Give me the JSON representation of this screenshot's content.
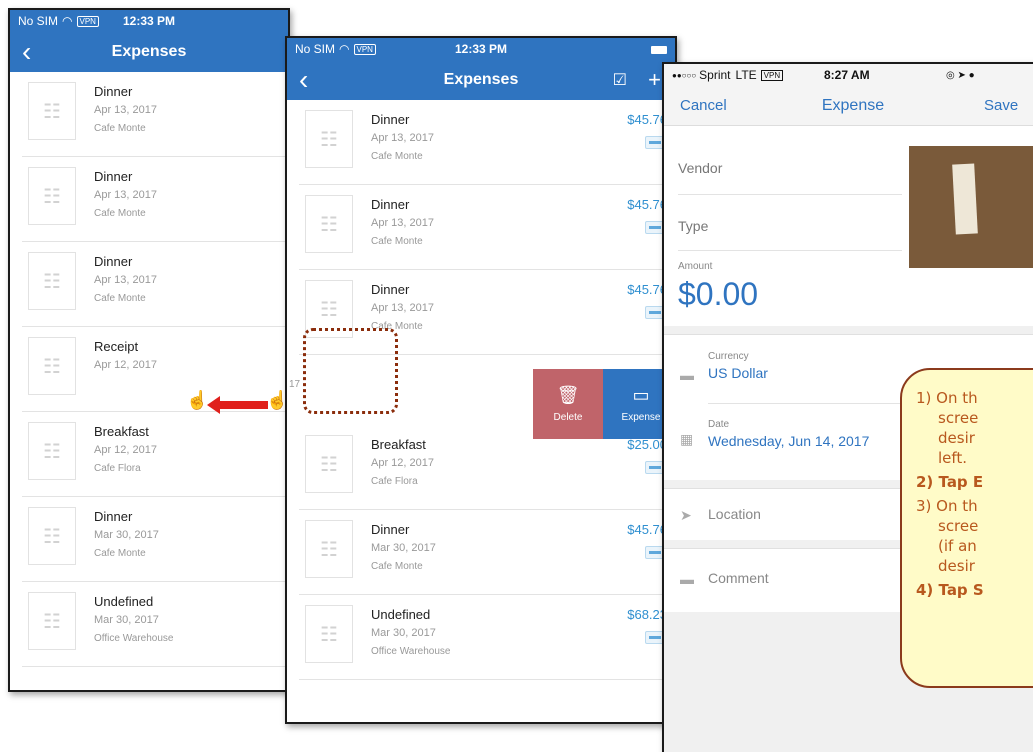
{
  "screen1": {
    "status": {
      "carrier": "No SIM",
      "vpn": "VPN",
      "time": "12:33 PM"
    },
    "nav": {
      "back_icon": "chevron-left-icon",
      "title": "Expenses"
    },
    "rows": [
      {
        "title": "Dinner",
        "date": "Apr 13, 2017",
        "vendor": "Cafe Monte"
      },
      {
        "title": "Dinner",
        "date": "Apr 13, 2017",
        "vendor": "Cafe Monte"
      },
      {
        "title": "Dinner",
        "date": "Apr 13, 2017",
        "vendor": "Cafe Monte"
      },
      {
        "title": "Receipt",
        "date": "Apr 12, 2017",
        "vendor": ""
      },
      {
        "title": "Breakfast",
        "date": "Apr 12, 2017",
        "vendor": "Cafe Flora"
      },
      {
        "title": "Dinner",
        "date": "Mar 30, 2017",
        "vendor": "Cafe Monte"
      },
      {
        "title": "Undefined",
        "date": "Mar 30, 2017",
        "vendor": "Office Warehouse"
      }
    ]
  },
  "screen2": {
    "status": {
      "carrier": "No SIM",
      "vpn": "VPN",
      "time": "12:33 PM"
    },
    "nav": {
      "title": "Expenses",
      "select_icon": "checkbox-icon",
      "add_icon": "plus-icon",
      "add_label": "+"
    },
    "rows": [
      {
        "title": "Dinner",
        "date": "Apr 13, 2017",
        "vendor": "Cafe Monte",
        "amount": "$45.76"
      },
      {
        "title": "Dinner",
        "date": "Apr 13, 2017",
        "vendor": "Cafe Monte",
        "amount": "$45.76"
      },
      {
        "title": "Dinner",
        "date": "Apr 13, 2017",
        "vendor": "Cafe Monte",
        "amount": "$45.76"
      },
      {
        "title": "Breakfast",
        "date": "Apr 12, 2017",
        "vendor": "Cafe Flora",
        "amount": "$25.00"
      },
      {
        "title": "Dinner",
        "date": "Mar 30, 2017",
        "vendor": "Cafe Monte",
        "amount": "$45.76"
      },
      {
        "title": "Undefined",
        "date": "Mar 30, 2017",
        "vendor": "Office Warehouse",
        "amount": "$68.23"
      }
    ],
    "swiped_partial": "17",
    "actions": {
      "delete": "Delete",
      "expense": "Expense"
    }
  },
  "screen3": {
    "status": {
      "carrier": "Sprint",
      "network": "LTE",
      "vpn": "VPN",
      "time": "8:27 AM"
    },
    "nav": {
      "cancel": "Cancel",
      "title": "Expense",
      "save": "Save"
    },
    "vendor_label": "Vendor",
    "type_label": "Type",
    "amount_label": "Amount",
    "amount_value": "$0.00",
    "currency_label": "Currency",
    "currency_value": "US Dollar",
    "date_label": "Date",
    "date_value": "Wednesday, Jun 14, 2017",
    "location_label": "Location",
    "comment_label": "Comment"
  },
  "callout": {
    "step1_a": "1) On th",
    "step1_b": "scree",
    "step1_c": "desir",
    "step1_d": "left.",
    "step2": "2) Tap E",
    "step3_a": "3) On th",
    "step3_b": "scree",
    "step3_c": "(if an",
    "step3_d": "desir",
    "step4": "4) Tap S"
  },
  "colors": {
    "brand_blue": "#2f74c0",
    "amount_blue": "#2f8fd0",
    "delete_red": "#c0646a",
    "callout_bg": "#fffbc8",
    "callout_text": "#b8581e"
  }
}
